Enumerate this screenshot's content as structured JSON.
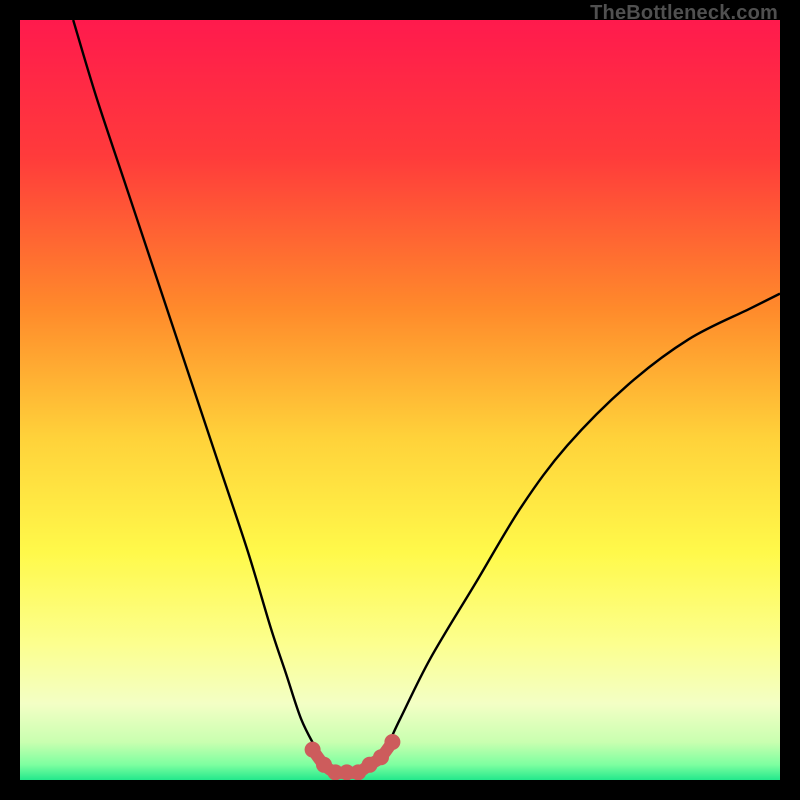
{
  "watermark": "TheBottleneck.com",
  "colors": {
    "background": "#000000",
    "curve": "#000000",
    "marker": "#cd5c5c",
    "gradient_stops": [
      {
        "pct": 0,
        "color": "#ff1a4d"
      },
      {
        "pct": 18,
        "color": "#ff3b3b"
      },
      {
        "pct": 38,
        "color": "#ff8a2b"
      },
      {
        "pct": 55,
        "color": "#ffd23a"
      },
      {
        "pct": 70,
        "color": "#fff94a"
      },
      {
        "pct": 82,
        "color": "#fcff8e"
      },
      {
        "pct": 90,
        "color": "#f3ffc5"
      },
      {
        "pct": 95,
        "color": "#c9ffb0"
      },
      {
        "pct": 98,
        "color": "#7dffa0"
      },
      {
        "pct": 100,
        "color": "#23e88c"
      }
    ]
  },
  "chart_data": {
    "type": "line",
    "title": "",
    "xlabel": "",
    "ylabel": "",
    "xlim": [
      0,
      100
    ],
    "ylim": [
      0,
      100
    ],
    "series": [
      {
        "name": "bottleneck-curve",
        "x": [
          7,
          10,
          14,
          18,
          22,
          26,
          30,
          33,
          35,
          37,
          39,
          40,
          42,
          44,
          46,
          48,
          50,
          54,
          60,
          66,
          72,
          80,
          88,
          96,
          100
        ],
        "y": [
          100,
          90,
          78,
          66,
          54,
          42,
          30,
          20,
          14,
          8,
          4,
          2,
          1,
          1,
          2,
          4,
          8,
          16,
          26,
          36,
          44,
          52,
          58,
          62,
          64
        ]
      }
    ],
    "markers": {
      "name": "optimal-range-markers",
      "x": [
        38.5,
        40,
        41.5,
        43,
        44.5,
        46,
        47.5,
        49
      ],
      "y": [
        4,
        2,
        1,
        1,
        1,
        2,
        3,
        5
      ]
    }
  }
}
